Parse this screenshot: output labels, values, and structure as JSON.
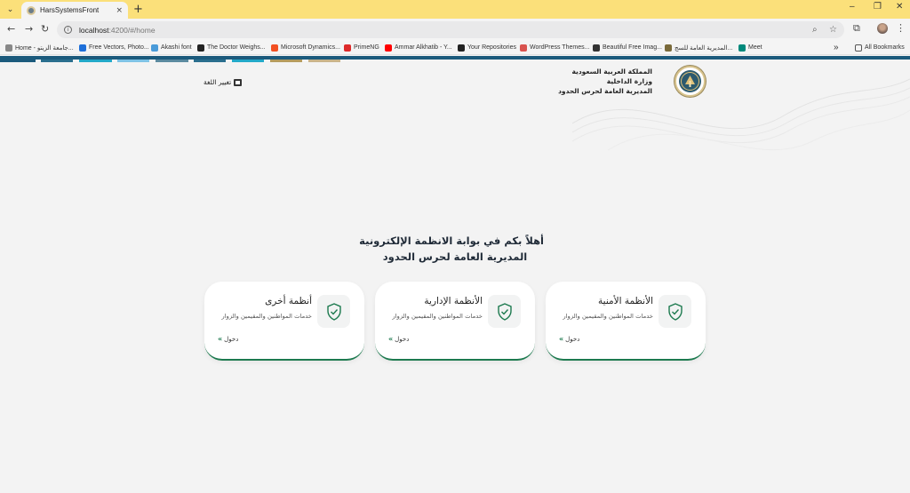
{
  "browser": {
    "tab_title": "HarsSystemsFront",
    "tab_close": "×",
    "new_tab": "+",
    "url_host": "localhost",
    "url_rest": ":4200/#/home",
    "window_controls": [
      "–",
      "❐",
      "✕"
    ],
    "avatar_label": ""
  },
  "bookmarks": [
    {
      "label": "Home - جامعة الزيتو...",
      "color": "#888888"
    },
    {
      "label": "Free Vectors, Photo...",
      "color": "#1e6fd9"
    },
    {
      "label": "Akashi font",
      "color": "#4a9bd9"
    },
    {
      "label": "The Doctor Weighs...",
      "color": "#222222"
    },
    {
      "label": "Microsoft Dynamics...",
      "color": "#f25022"
    },
    {
      "label": "PrimeNG",
      "color": "#dd2a2a"
    },
    {
      "label": "Ammar Alkhatib - Y...",
      "color": "#ff0000"
    },
    {
      "label": "Your Repositories",
      "color": "#222222"
    },
    {
      "label": "WordPress Themes...",
      "color": "#d9534f"
    },
    {
      "label": "Beautiful Free Imag...",
      "color": "#333333"
    },
    {
      "label": "المديرية العامة للسج...",
      "color": "#7a6a3a"
    },
    {
      "label": "Meet",
      "color": "#00897b"
    }
  ],
  "bookmarks_more": "»",
  "all_bookmarks": "All Bookmarks",
  "header": {
    "gov_lines": [
      "المملكة العربية السعودية",
      "وزارة الداخلية",
      "المديرية العامة لحرس الحدود"
    ],
    "lang_toggle": "تغيير اللغة"
  },
  "welcome": {
    "line1": "أهلاً بكم في بوابة الانظمة الإلكترونية",
    "line2": "المديرية العامة لحرس الحدود"
  },
  "cards": [
    {
      "title": "الأنظمة الأمنية",
      "desc": "خدمات المواطنين والمقيمين والزوار",
      "enter": "دخول"
    },
    {
      "title": "الأنظمة الإدارية",
      "desc": "خدمات المواطنين والمقيمين والزوار",
      "enter": "دخول"
    },
    {
      "title": "أنظمة أخرى",
      "desc": "خدمات المواطنين والمقيمين والزوار",
      "enter": "دخول"
    }
  ],
  "colors": {
    "accent_green": "#1d7a4f",
    "top_stripe": "#1b5a7c",
    "titlebar": "#fbe07a"
  }
}
